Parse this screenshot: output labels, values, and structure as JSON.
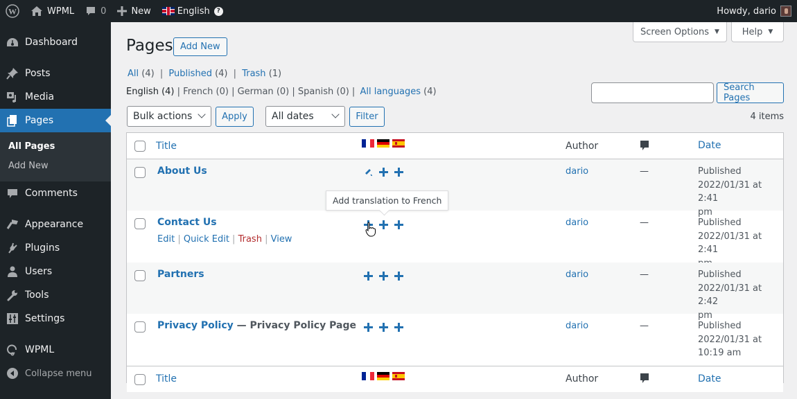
{
  "admin_bar": {
    "site_name": "WPML",
    "comments_count": "0",
    "new_label": "New",
    "language": "English",
    "help_glyph": "?",
    "greeting": "Howdy, dario",
    "icons": [
      "wordpress-logo-icon",
      "home-icon",
      "comment-icon",
      "plus-icon",
      "uk-flag-icon",
      "help-icon",
      "avatar"
    ]
  },
  "sidebar": {
    "items": [
      {
        "label": "Dashboard",
        "icon": "dashboard-icon"
      },
      {
        "label": "Posts",
        "icon": "pin-icon"
      },
      {
        "label": "Media",
        "icon": "media-icon"
      },
      {
        "label": "Pages",
        "icon": "pages-icon",
        "current": true
      },
      {
        "label": "Comments",
        "icon": "comment-icon"
      },
      {
        "label": "Appearance",
        "icon": "brush-icon"
      },
      {
        "label": "Plugins",
        "icon": "plug-icon"
      },
      {
        "label": "Users",
        "icon": "user-icon"
      },
      {
        "label": "Tools",
        "icon": "wrench-icon"
      },
      {
        "label": "Settings",
        "icon": "sliders-icon"
      },
      {
        "label": "WPML",
        "icon": "wpml-icon"
      }
    ],
    "submenu": [
      {
        "label": "All Pages",
        "current": true
      },
      {
        "label": "Add New"
      }
    ],
    "collapse_label": "Collapse menu"
  },
  "header": {
    "screen_options": "Screen Options",
    "help": "Help",
    "title": "Pages",
    "add_new": "Add New"
  },
  "filters": {
    "status": [
      {
        "label": "All",
        "count": "(4)"
      },
      {
        "label": "Published",
        "count": "(4)"
      },
      {
        "label": "Trash",
        "count": "(1)"
      }
    ],
    "languages": [
      {
        "label": "English",
        "count": "(4)",
        "current": true
      },
      {
        "label": "French",
        "count": "(0)"
      },
      {
        "label": "German",
        "count": "(0)"
      },
      {
        "label": "Spanish",
        "count": "(0)"
      },
      {
        "label": "All languages",
        "count": "(4)",
        "link": true
      }
    ],
    "bulk_actions": "Bulk actions",
    "apply": "Apply",
    "dates": "All dates",
    "filter": "Filter",
    "search_value": "",
    "search_button": "Search Pages",
    "items_count": "4 items"
  },
  "table": {
    "columns": {
      "title": "Title",
      "flags": [
        "French",
        "German",
        "Spanish"
      ],
      "author": "Author",
      "comments_icon": "comment-icon",
      "date": "Date"
    },
    "rows": [
      {
        "title": "About Us",
        "state": "",
        "translations": [
          "edit",
          "add",
          "add"
        ],
        "author": "dario",
        "comments": "—",
        "date_status": "Published",
        "date_line1": "2022/01/31 at 2:41",
        "date_line2": "pm"
      },
      {
        "title": "Contact Us",
        "state": "",
        "translations": [
          "add",
          "add",
          "add"
        ],
        "author": "dario",
        "comments": "—",
        "date_status": "Published",
        "date_line1": "2022/01/31 at 2:41",
        "date_line2": "pm",
        "row_actions": {
          "edit": "Edit",
          "quick_edit": "Quick Edit",
          "trash": "Trash",
          "view": "View"
        }
      },
      {
        "title": "Partners",
        "state": "",
        "translations": [
          "add",
          "add",
          "add"
        ],
        "author": "dario",
        "comments": "—",
        "date_status": "Published",
        "date_line1": "2022/01/31 at 2:42",
        "date_line2": "pm"
      },
      {
        "title": "Privacy Policy",
        "state": " — Privacy Policy Page",
        "translations": [
          "add",
          "add",
          "add"
        ],
        "author": "dario",
        "comments": "—",
        "date_status": "Published",
        "date_line1": "2022/01/31 at",
        "date_line2": "10:19 am"
      }
    ],
    "tooltip": "Add translation to French"
  },
  "colors": {
    "accent": "#2271b1",
    "admin_bar_bg": "#1d2327",
    "trash": "#b32d2e"
  }
}
